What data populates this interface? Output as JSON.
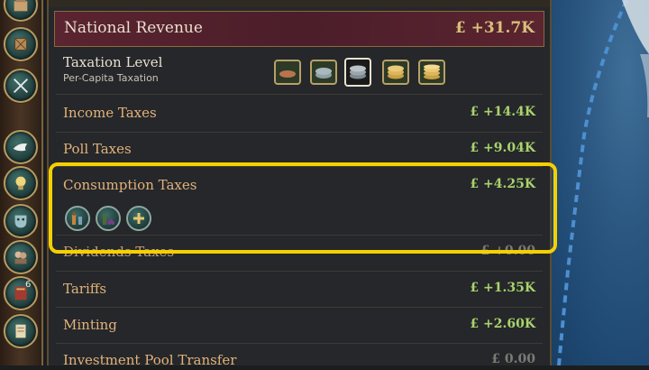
{
  "header": {
    "title": "National Revenue",
    "value": "£ +31.7K"
  },
  "taxation": {
    "label": "Taxation Level",
    "sublabel": "Per-Capita Taxation",
    "levels": [
      "very-low",
      "low",
      "medium",
      "high",
      "very-high"
    ],
    "selected_level": "medium"
  },
  "rows": {
    "income": {
      "label": "Income Taxes",
      "value": "£ +14.4K"
    },
    "poll": {
      "label": "Poll Taxes",
      "value": "£ +9.04K"
    },
    "consumption": {
      "label": "Consumption Taxes",
      "value": "£ +4.25K"
    },
    "dividends": {
      "label": "Dividends Taxes",
      "value": "£ +0.00"
    },
    "tariffs": {
      "label": "Tariffs",
      "value": "£ +1.35K"
    },
    "minting": {
      "label": "Minting",
      "value": "£ +2.60K"
    },
    "investment": {
      "label": "Investment Pool Transfer",
      "value": "£ 0.00"
    }
  },
  "consumption_goods": [
    "liquor-icon",
    "wine-icon",
    "add-icon"
  ],
  "sidebar": {
    "icons": [
      "building-icon",
      "crate-icon",
      "crossed-swords-icon",
      "dove-icon",
      "lightbulb-icon",
      "theater-mask-icon",
      "people-icon",
      "book-icon",
      "scroll-icon"
    ],
    "book_badge": "6"
  },
  "colors": {
    "highlight": "#f5d000",
    "header_bg": "#5a2430",
    "positive_value": "#a9d36c",
    "label_orange": "#e3b27b"
  }
}
